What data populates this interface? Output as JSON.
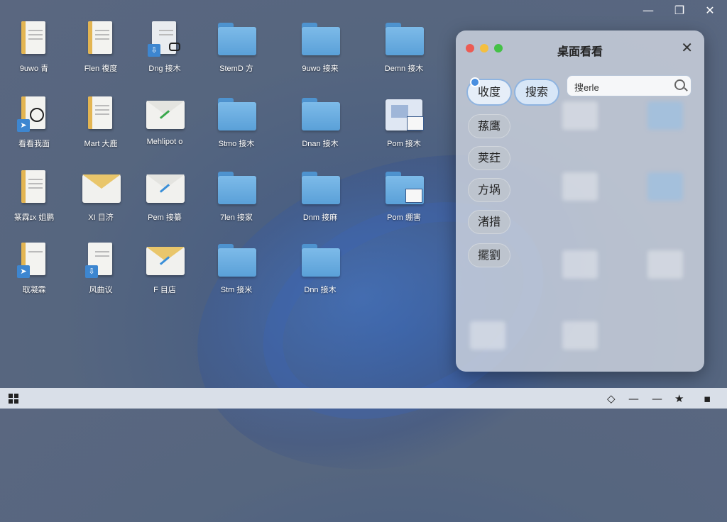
{
  "window_controls": {
    "minimize": "—",
    "maximize": "❐",
    "close": "✕"
  },
  "desktop": {
    "row1": [
      "9uwo 青",
      "Flen 複度",
      "Dng 接木",
      "StemD 方",
      "9uwo 接来",
      "Demn 接木"
    ],
    "row2": [
      "看看我面",
      "Mart 大鹿",
      "Mehlipot o",
      "Stmo 接木",
      "Dnan 接木",
      "Pom 接木"
    ],
    "row3": [
      "篆霖ɪx 姐鹏",
      "XI 目济",
      "Pem 接纂",
      "7len 接家",
      "Dnm 接麻",
      "Pom 绷害"
    ],
    "row4": [
      "取凝霖",
      "风曲议",
      "F 目店",
      "Stm 接米",
      "Dnn 接木"
    ]
  },
  "panel": {
    "title": "桌面看看",
    "close": "✕",
    "chips": [
      "收度",
      "蓀鹰",
      "荚荭",
      "方埚",
      "渚措",
      "擺劉"
    ],
    "search_chip": "搜索",
    "search_text": "搜erle"
  },
  "taskbar": {
    "start_icon": "windows-logo",
    "tray": [
      "◇",
      "—",
      "—",
      "★",
      "▪"
    ]
  }
}
